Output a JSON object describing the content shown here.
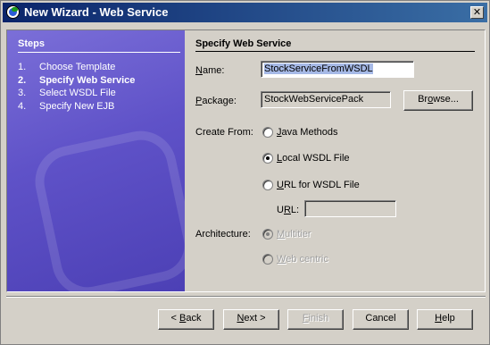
{
  "window": {
    "title": "New Wizard - Web Service",
    "close_glyph": "✕"
  },
  "steps": {
    "header": "Steps",
    "items": [
      {
        "num": "1.",
        "label": "Choose Template"
      },
      {
        "num": "2.",
        "label": "Specify Web Service"
      },
      {
        "num": "3.",
        "label": "Select WSDL File"
      },
      {
        "num": "4.",
        "label": "Specify New EJB"
      }
    ]
  },
  "main": {
    "title": "Specify Web Service",
    "name": {
      "label_first": "N",
      "label_rest": "ame:",
      "value": "StockServiceFromWSDL"
    },
    "package": {
      "label_first": "P",
      "label_rest": "ackage:",
      "value": "StockWebServicePack"
    },
    "browse_button": {
      "label_first": "Br",
      "label_u": "o",
      "label_rest": "wse..."
    },
    "create_from": {
      "label": "Create From:",
      "options": [
        {
          "first": "J",
          "rest": "ava Methods",
          "checked": false
        },
        {
          "first": "L",
          "rest": "ocal WSDL File",
          "checked": true
        },
        {
          "first": "U",
          "rest": "RL for WSDL File",
          "checked": false
        }
      ]
    },
    "url": {
      "label_first": "U",
      "label_u": "R",
      "label_rest": "L:",
      "value": ""
    },
    "architecture": {
      "label": "Architecture:",
      "options": [
        {
          "first": "M",
          "rest": "ultitier",
          "checked": true
        },
        {
          "first": "W",
          "rest": "eb centric",
          "checked": false
        }
      ]
    }
  },
  "footer": {
    "back": {
      "prefix": "< ",
      "u": "B",
      "rest": "ack"
    },
    "next": {
      "u": "N",
      "rest": "ext >"
    },
    "finish": {
      "u": "F",
      "rest": "inish"
    },
    "cancel": {
      "label": "Cancel"
    },
    "help": {
      "u": "H",
      "rest": "elp"
    }
  },
  "colors": {
    "titlebar_start": "#0a246a",
    "steps_panel": "#5f52c8",
    "selection": "#a6b9e6"
  }
}
